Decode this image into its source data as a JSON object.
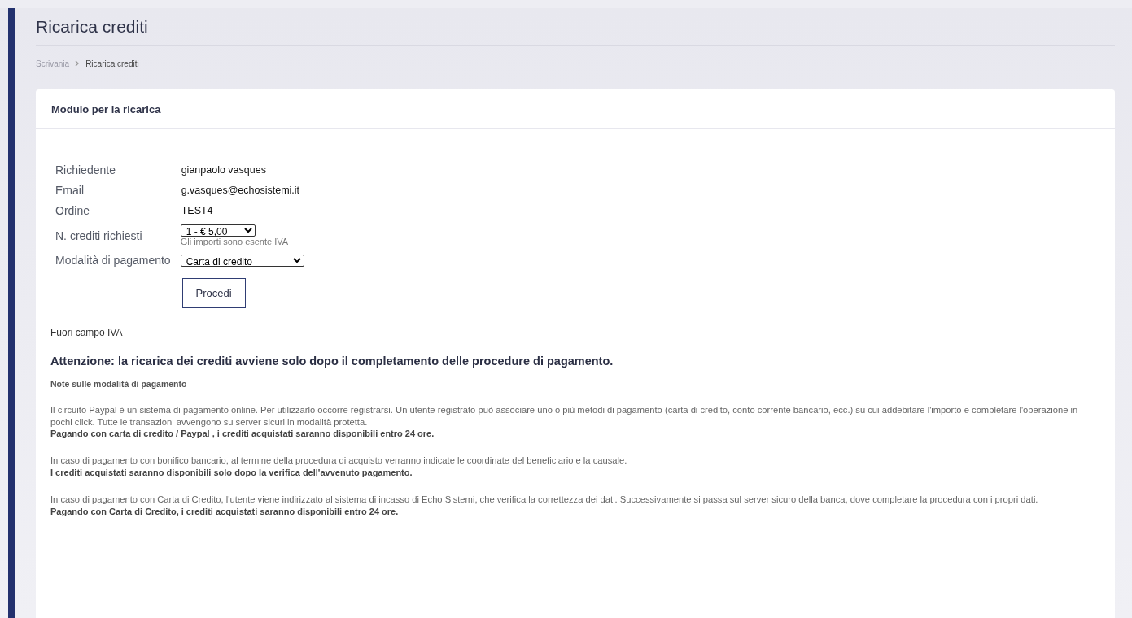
{
  "page_title": "Ricarica crediti",
  "breadcrumb": [
    {
      "label": "Scrivania",
      "current": false
    },
    {
      "label": "Ricarica crediti",
      "current": true
    }
  ],
  "card": {
    "title": "Modulo per la ricarica",
    "fields": [
      {
        "kind": "text",
        "label": "Richiedente",
        "value": "gianpaolo vasques"
      },
      {
        "kind": "text",
        "label": "Email",
        "value": "g.vasques@echosistemi.it"
      },
      {
        "kind": "text",
        "label": "Ordine",
        "value": "TEST4"
      },
      {
        "kind": "select",
        "label": "N. crediti richiesti",
        "value": "1 - € 5,00",
        "hint": "Gli importi sono esente IVA"
      },
      {
        "kind": "select",
        "label": "Modalità di pagamento",
        "value": "Carta di credito"
      }
    ],
    "submit": "Procedi",
    "vat_note": "Fuori campo IVA",
    "warning": "Attenzione: la ricarica dei crediti avviene solo dopo il completamento delle procedure di pagamento.",
    "notes_title": "Note sulle modalità di pagamento",
    "notes": [
      {
        "text": "Il circuito Paypal è un sistema di pagamento online. Per utilizzarlo occorre registrarsi. Un utente registrato può associare uno o più metodi di pagamento (carta di credito, conto corrente bancario, ecc.) su cui addebitare l'importo e completare l'operazione in pochi click. Tutte le transazioni avvengono su server sicuri in modalità protetta.",
        "bold": "Pagando con carta di credito / Paypal , i crediti acquistati saranno disponibili entro 24 ore."
      },
      {
        "text": "In caso di pagamento con bonifico bancario, al termine della procedura di acquisto verranno indicate le coordinate del beneficiario e la causale.",
        "bold": "I crediti acquistati saranno disponibili solo dopo la verifica dell'avvenuto pagamento."
      },
      {
        "text": "In caso di pagamento con Carta di Credito, l'utente viene indirizzato al sistema di incasso di Echo Sistemi, che verifica la correttezza dei dati. Successivamente si passa sul server sicuro della banca, dove completare la procedura con i propri dati.",
        "bold": "Pagando con Carta di Credito, i crediti acquistati saranno disponibili entro 24 ore."
      }
    ]
  }
}
